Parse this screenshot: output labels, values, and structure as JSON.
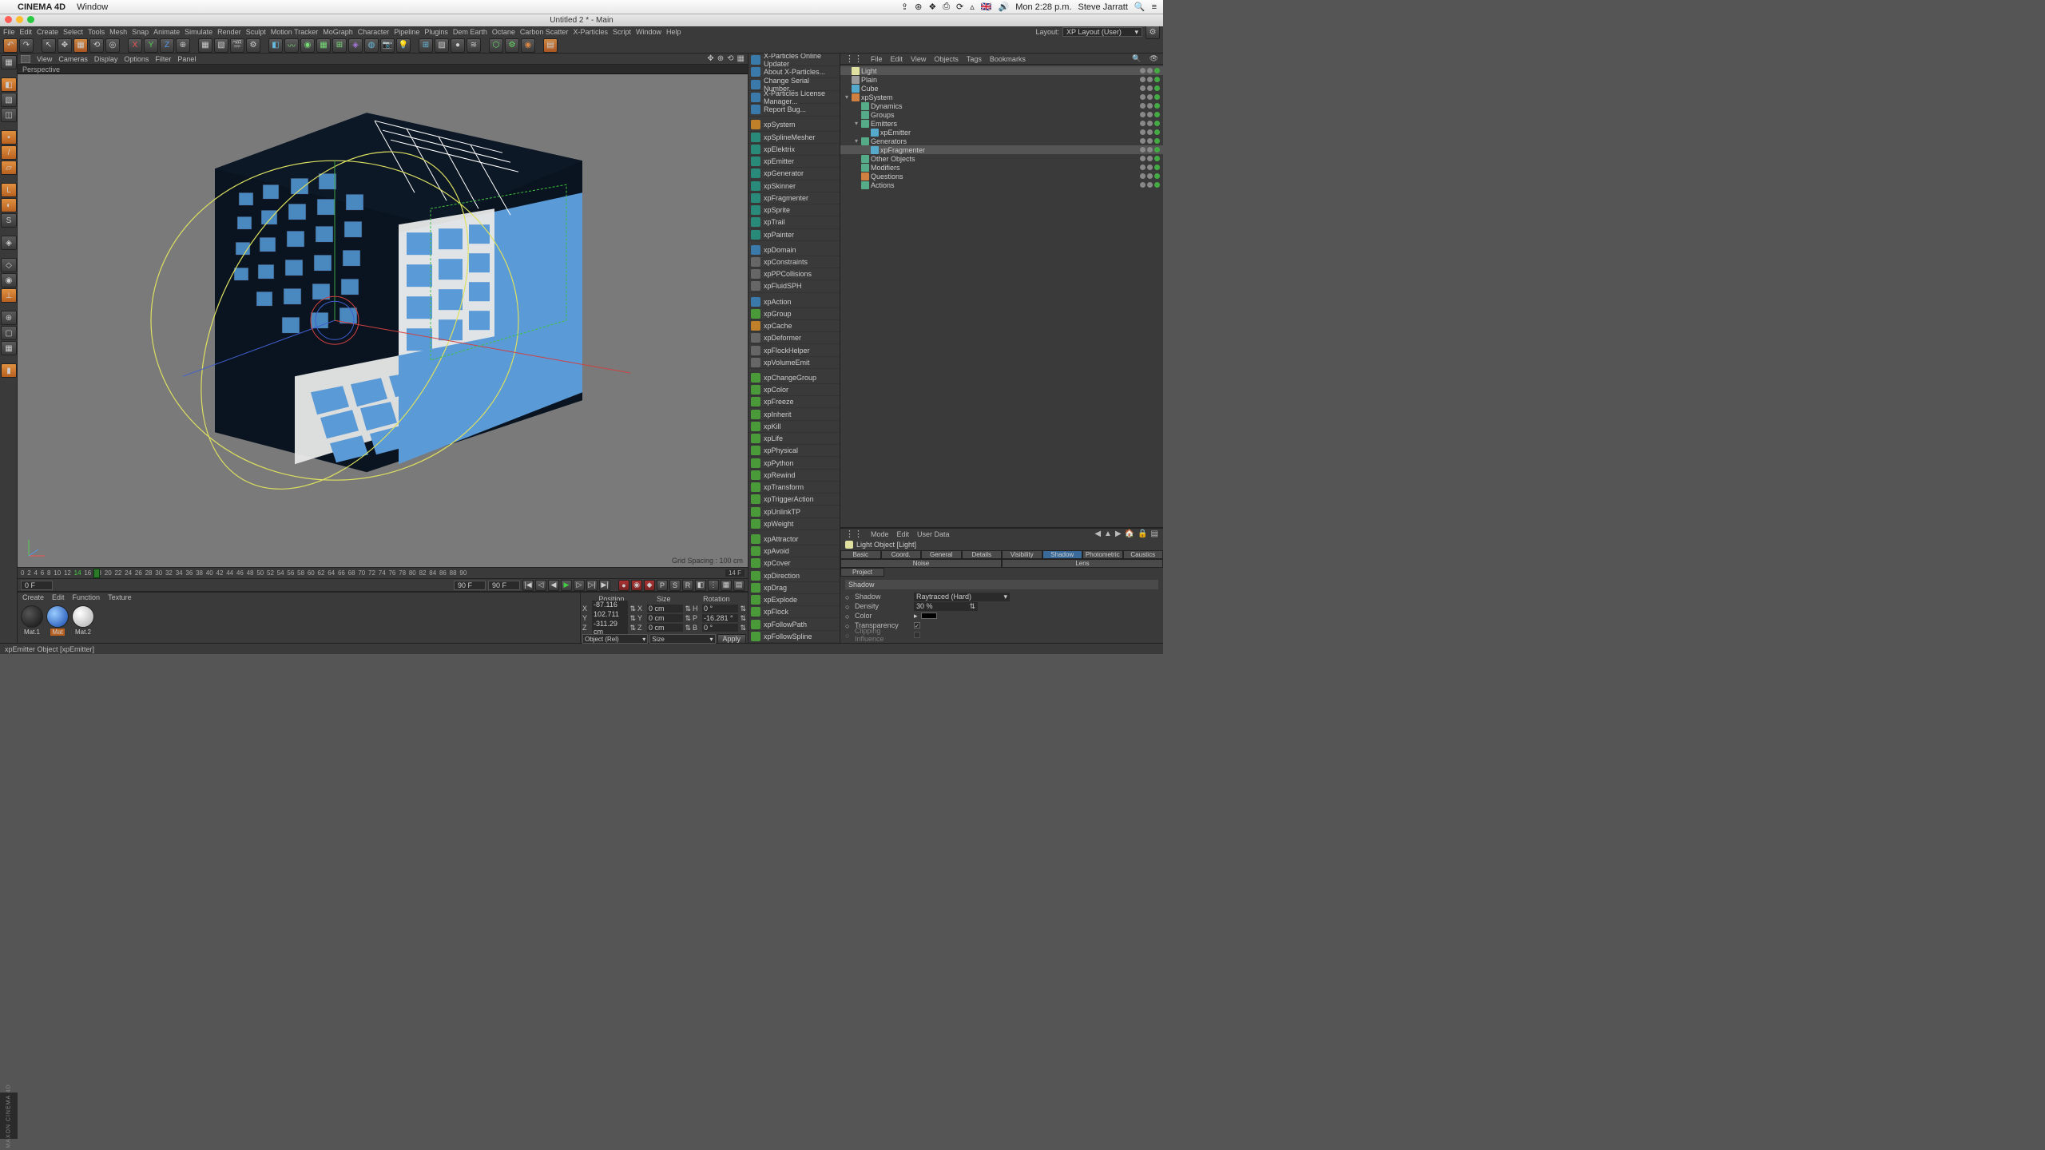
{
  "mac": {
    "appname": "CINEMA 4D",
    "menus": [
      "Window"
    ],
    "clock": "Mon 2:28 p.m.",
    "user": "Steve Jarratt"
  },
  "title": "Untitled 2 * - Main",
  "app_menus": [
    "File",
    "Edit",
    "Create",
    "Select",
    "Tools",
    "Mesh",
    "Snap",
    "Animate",
    "Simulate",
    "Render",
    "Sculpt",
    "Motion Tracker",
    "MoGraph",
    "Character",
    "Pipeline",
    "Plugins",
    "Dem Earth",
    "Octane",
    "Carbon Scatter",
    "X-Particles",
    "Script",
    "Window",
    "Help"
  ],
  "layout_label": "Layout:",
  "layout_value": "XP Layout (User)",
  "viewport": {
    "menus": [
      "View",
      "Cameras",
      "Display",
      "Options",
      "Filter",
      "Panel"
    ],
    "tab": "Perspective",
    "grid_text": "Grid Spacing : 100 cm"
  },
  "timeline": {
    "start": "0 F",
    "cur": "14",
    "end": "90 F",
    "range_end": "90 F"
  },
  "materials": {
    "menus": [
      "Create",
      "Edit",
      "Function",
      "Texture"
    ],
    "items": [
      "Mat.1",
      "Mat",
      "Mat.2"
    ]
  },
  "coords": {
    "headers": [
      "Position",
      "Size",
      "Rotation"
    ],
    "rows": [
      {
        "l": "X",
        "p": "-87.116 cm",
        "sl": "X",
        "s": "0 cm",
        "rl": "H",
        "r": "0 °"
      },
      {
        "l": "Y",
        "p": "102.711 cm",
        "sl": "Y",
        "s": "0 cm",
        "rl": "P",
        "r": "-16.281 °"
      },
      {
        "l": "Z",
        "p": "-311.29 cm",
        "sl": "Z",
        "s": "0 cm",
        "rl": "B",
        "r": "0 °"
      }
    ],
    "sel1": "Object (Rel)",
    "sel2": "Size",
    "apply": "Apply"
  },
  "xp_groups": [
    {
      "sep": false,
      "items": [
        {
          "ic": "ic-blue",
          "label": "X-Particles Online Updater"
        },
        {
          "ic": "ic-blue",
          "label": "About X-Particles..."
        },
        {
          "ic": "ic-blue",
          "label": "Change Serial Number..."
        },
        {
          "ic": "ic-blue",
          "label": "X-Particles License Manager..."
        },
        {
          "ic": "ic-blue",
          "label": "Report Bug..."
        }
      ]
    },
    {
      "sep": true,
      "items": [
        {
          "ic": "ic-orange",
          "label": "xpSystem"
        },
        {
          "ic": "ic-teal",
          "label": "xpSplineMesher"
        },
        {
          "ic": "ic-teal",
          "label": "xpElektrix"
        },
        {
          "ic": "ic-teal",
          "label": "xpEmitter"
        },
        {
          "ic": "ic-teal",
          "label": "xpGenerator"
        },
        {
          "ic": "ic-teal",
          "label": "xpSkinner"
        },
        {
          "ic": "ic-teal",
          "label": "xpFragmenter"
        },
        {
          "ic": "ic-teal",
          "label": "xpSprite"
        },
        {
          "ic": "ic-teal",
          "label": "xpTrail"
        },
        {
          "ic": "ic-teal",
          "label": "xpPainter"
        }
      ]
    },
    {
      "sep": true,
      "items": [
        {
          "ic": "ic-blue",
          "label": "xpDomain"
        },
        {
          "ic": "ic-gray",
          "label": "xpConstraints"
        },
        {
          "ic": "ic-gray",
          "label": "xpPPCollisions"
        },
        {
          "ic": "ic-gray",
          "label": "xpFluidSPH"
        }
      ]
    },
    {
      "sep": true,
      "items": [
        {
          "ic": "ic-blue",
          "label": "xpAction"
        },
        {
          "ic": "ic-green",
          "label": "xpGroup"
        },
        {
          "ic": "ic-orange",
          "label": "xpCache"
        },
        {
          "ic": "ic-gray",
          "label": "xpDeformer"
        },
        {
          "ic": "ic-gray",
          "label": "xpFlockHelper"
        },
        {
          "ic": "ic-gray",
          "label": "xpVolumeEmit"
        }
      ]
    },
    {
      "sep": true,
      "items": [
        {
          "ic": "ic-green",
          "label": "xpChangeGroup"
        },
        {
          "ic": "ic-green",
          "label": "xpColor"
        },
        {
          "ic": "ic-green",
          "label": "xpFreeze"
        },
        {
          "ic": "ic-green",
          "label": "xpInherit"
        },
        {
          "ic": "ic-green",
          "label": "xpKill"
        },
        {
          "ic": "ic-green",
          "label": "xpLife"
        },
        {
          "ic": "ic-green",
          "label": "xpPhysical"
        },
        {
          "ic": "ic-green",
          "label": "xpPython"
        },
        {
          "ic": "ic-green",
          "label": "xpRewind"
        },
        {
          "ic": "ic-green",
          "label": "xpTransform"
        },
        {
          "ic": "ic-green",
          "label": "xpTriggerAction"
        },
        {
          "ic": "ic-green",
          "label": "xpUnlinkTP"
        },
        {
          "ic": "ic-green",
          "label": "xpWeight"
        }
      ]
    },
    {
      "sep": true,
      "items": [
        {
          "ic": "ic-green",
          "label": "xpAttractor"
        },
        {
          "ic": "ic-green",
          "label": "xpAvoid"
        },
        {
          "ic": "ic-green",
          "label": "xpCover"
        },
        {
          "ic": "ic-green",
          "label": "xpDirection"
        },
        {
          "ic": "ic-green",
          "label": "xpDrag"
        },
        {
          "ic": "ic-green",
          "label": "xpExplode"
        },
        {
          "ic": "ic-green",
          "label": "xpFlock"
        },
        {
          "ic": "ic-green",
          "label": "xpFollowPath"
        },
        {
          "ic": "ic-green",
          "label": "xpFollowSpline"
        }
      ]
    }
  ],
  "obj_menus": [
    "File",
    "Edit",
    "View",
    "Objects",
    "Tags",
    "Bookmarks"
  ],
  "tree": [
    {
      "d": 0,
      "exp": "",
      "ic": "#e0e0a0",
      "label": "Light",
      "sel": true
    },
    {
      "d": 0,
      "exp": "",
      "ic": "#999",
      "label": "Plain"
    },
    {
      "d": 0,
      "exp": "",
      "ic": "#5ac",
      "label": "Cube"
    },
    {
      "d": 0,
      "exp": "▾",
      "ic": "#d08040",
      "label": "xpSystem"
    },
    {
      "d": 1,
      "exp": "",
      "ic": "#5a8",
      "label": "Dynamics"
    },
    {
      "d": 1,
      "exp": "",
      "ic": "#5a8",
      "label": "Groups"
    },
    {
      "d": 1,
      "exp": "▾",
      "ic": "#5a8",
      "label": "Emitters"
    },
    {
      "d": 2,
      "exp": "",
      "ic": "#5ac",
      "label": "xpEmitter"
    },
    {
      "d": 1,
      "exp": "▾",
      "ic": "#5a8",
      "label": "Generators"
    },
    {
      "d": 2,
      "exp": "",
      "ic": "#5ac",
      "label": "xpFragmenter",
      "sel": true
    },
    {
      "d": 1,
      "exp": "",
      "ic": "#5a8",
      "label": "Other Objects"
    },
    {
      "d": 1,
      "exp": "",
      "ic": "#5a8",
      "label": "Modifiers"
    },
    {
      "d": 1,
      "exp": "",
      "ic": "#d08040",
      "label": "Questions"
    },
    {
      "d": 1,
      "exp": "",
      "ic": "#5a8",
      "label": "Actions"
    }
  ],
  "attr": {
    "menus": [
      "Mode",
      "Edit",
      "User Data"
    ],
    "title": "Light Object [Light]",
    "tabs1": [
      "Basic",
      "Coord.",
      "General",
      "Details",
      "Visibility",
      "Shadow",
      "Photometric",
      "Caustics",
      "Noise",
      "Lens"
    ],
    "tabs2": [
      "Project"
    ],
    "active_tab": "Shadow",
    "group": "Shadow",
    "shadow_label": "Shadow",
    "shadow_val": "Raytraced (Hard)",
    "density_label": "Density",
    "density_val": "30 %",
    "color_label": "Color",
    "transparency_label": "Transparency",
    "clipping_label": "Clipping Influence"
  },
  "status": "xpEmitter Object [xpEmitter]",
  "maxon": "MAXON CINEMA 4D"
}
